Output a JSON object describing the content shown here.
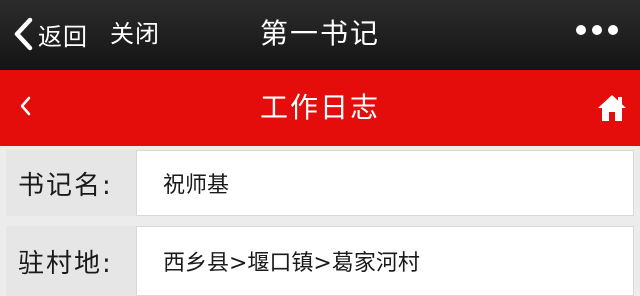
{
  "topbar": {
    "back_label": "返回",
    "close_label": "关闭",
    "title": "第一书记"
  },
  "header": {
    "title": "工作日志",
    "accent_color": "#e50c0c"
  },
  "icons": {
    "back": "chevron-left-icon",
    "more": "more-dots-icon",
    "header_back": "chevron-left-icon",
    "home": "home-icon"
  },
  "fields": [
    {
      "label": "书记名:",
      "value": "祝师基"
    },
    {
      "label": "驻村地:",
      "value": "西乡县>堰口镇>葛家河村"
    }
  ]
}
